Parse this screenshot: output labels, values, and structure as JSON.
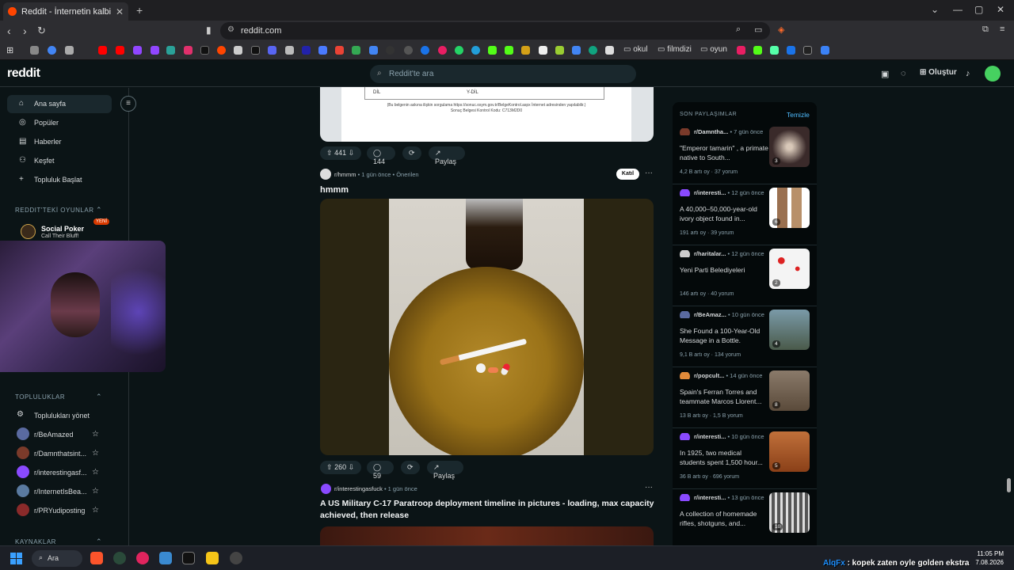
{
  "browser": {
    "tab_title": "Reddit - İnternetin kalbi",
    "url": "reddit.com",
    "bookmark_folders": [
      "okul",
      "filmdizi",
      "oyun"
    ]
  },
  "header": {
    "logo": "reddit",
    "search_placeholder": "Reddit'te ara",
    "create_label": "Oluştur"
  },
  "sidebar": {
    "nav": [
      {
        "label": "Ana sayfa",
        "icon": "home-icon"
      },
      {
        "label": "Popüler",
        "icon": "popular-icon"
      },
      {
        "label": "Haberler",
        "icon": "news-icon"
      },
      {
        "label": "Keşfet",
        "icon": "explore-icon"
      },
      {
        "label": "Topluluk Başlat",
        "icon": "plus-icon"
      }
    ],
    "games_heading": "REDDIT'TEKİ OYUNLAR",
    "game": {
      "title": "Social Poker",
      "subtitle": "Call Their Bluff!",
      "badge": "YENİ"
    },
    "communities_heading": "TOPLULUKLAR",
    "manage_label": "Toplulukları yönet",
    "communities": [
      "r/BeAmazed",
      "r/Damnthatsint...",
      "r/interestingasf...",
      "r/InternetIsBea...",
      "r/PRYudiposting"
    ],
    "resources_heading": "KAYNAKLAR"
  },
  "feed": {
    "post0": {
      "image_caption_line1": "(Bu belgenin askına ilişkin sorgulama https://sonuc.osym.gov.tr/BelgeKontrol.aspx İnternet adresinden yapılabilir.)",
      "image_caption_line2": "Sonuç Belgesi Kontrol Kodu: C713M2D0",
      "table_cells": [
        "DİL",
        "Y-DİL"
      ],
      "votes": "441",
      "comments": "144",
      "share": "Paylaş"
    },
    "post1": {
      "subreddit": "r/hmmm",
      "time": "1 gün önce",
      "tag": "Önerilen",
      "join": "Katıl",
      "title": "hmmm",
      "votes": "260",
      "comments": "59",
      "share": "Paylaş"
    },
    "post2": {
      "subreddit": "r/interestingasfuck",
      "time": "1 gün önce",
      "title": "A US Military C-17 Paratroop deployment timeline in pictures - loading, max capacity achieved, then release"
    }
  },
  "recent": {
    "heading": "SON PAYLAŞIMLAR",
    "clear": "Temizle",
    "items": [
      {
        "sub": "r/Damntha...",
        "time": "7 gün önce",
        "title": "\"Emperor tamarin\" , a primate native to South...",
        "stats": "4,2 B artı oy  ·  37 yorum",
        "count": "3",
        "color": "#3a3030"
      },
      {
        "sub": "r/interesti...",
        "time": "12 gün önce",
        "title": "A 40,000–50,000-year-old ivory object found in...",
        "stats": "191 artı oy  ·  39 yorum",
        "count": "6",
        "color": "#8a6a50"
      },
      {
        "sub": "r/haritalar...",
        "time": "12 gün önce",
        "title": "Yeni Parti Belediyeleri",
        "stats": "146 artı oy  ·  40 yorum",
        "count": "2",
        "color": "#f0f0f0"
      },
      {
        "sub": "r/BeAmaz...",
        "time": "10 gün önce",
        "title": "She Found a 100-Year-Old Message in a Bottle.",
        "stats": "9,1 B artı oy  ·  134 yorum",
        "count": "4",
        "color": "#5a7a8a"
      },
      {
        "sub": "r/popcult...",
        "time": "14 gün önce",
        "title": "Spain's Ferran Torres and teammate Marcos Llorent...",
        "stats": "13 B artı oy  ·  1,5 B yorum",
        "count": "8",
        "color": "#7a6a5a"
      },
      {
        "sub": "r/interesti...",
        "time": "10 gün önce",
        "title": "In 1925, two medical students spent 1,500 hour...",
        "stats": "36 B artı oy  ·  696 yorum",
        "count": "5",
        "color": "#b0602a"
      },
      {
        "sub": "r/interesti...",
        "time": "13 gün önce",
        "title": "A collection of homemade rifles, shotguns, and...",
        "stats": "",
        "count": "10",
        "color": "#6a6a6a"
      }
    ]
  },
  "taskbar": {
    "search_label": "Ara",
    "time": "11:05 PM",
    "date": "7.08.2026",
    "ticker_user": "AlqFx",
    "ticker_text": ": kopek zaten oyle golden ekstra"
  }
}
